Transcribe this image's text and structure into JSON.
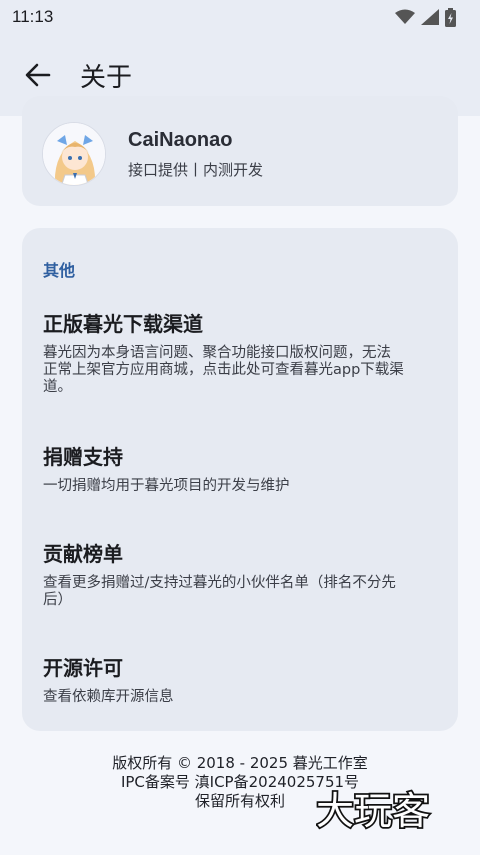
{
  "status_bar": {
    "time": "11:13",
    "icons": [
      "wifi-icon",
      "signal-icon",
      "battery-icon"
    ]
  },
  "app_bar": {
    "back_icon": "arrow-left-icon",
    "title": "关于"
  },
  "profile": {
    "name": "CaiNaonao",
    "description": "接口提供丨内测开发"
  },
  "other_section": {
    "header": "其他",
    "items": [
      {
        "title": "正版暮光下载渠道",
        "desc_lines": [
          "暮光因为本身语言问题、聚合功能接口版权问题，无法",
          "正常上架官方应用商城，点击此处可查看暮光app下载渠",
          "道。"
        ]
      },
      {
        "title": "捐赠支持",
        "desc_lines": [
          "一切捐赠均用于暮光项目的开发与维护"
        ]
      },
      {
        "title": "贡献榜单",
        "desc_lines": [
          "查看更多捐赠过/支持过暮光的小伙伴名单（排名不分先",
          "后）"
        ]
      },
      {
        "title": "开源许可",
        "desc_lines": [
          "查看依赖库开源信息"
        ]
      }
    ]
  },
  "footer": {
    "lines": [
      "版权所有 © 2018 - 2025 暮光工作室",
      "IPC备案号 滇ICP备2024025751号",
      "保留所有权利"
    ]
  },
  "watermark": {
    "text": "大玩客"
  },
  "colors": {
    "background": "#f4f6fb",
    "app_bar": "#e8ecf4",
    "card": "#e6eaf2",
    "section_accent": "#2f5fa0"
  }
}
